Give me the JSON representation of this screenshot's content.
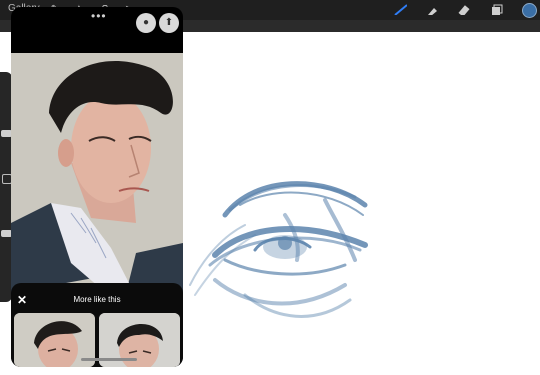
{
  "toolbar": {
    "gallery_label": "Gallery",
    "tools_left": [
      "wrench-icon",
      "magic-icon",
      "selection-icon",
      "transform-icon"
    ],
    "tools_right": [
      "brush-icon",
      "smudge-icon",
      "eraser-icon",
      "layers-icon"
    ],
    "active_color": "#3a6ea5"
  },
  "panel": {
    "more_like_this": "More like this",
    "close_icon": "✕",
    "dots": "•••"
  },
  "colors": {
    "sketch_stroke": "#5c84ad",
    "panel_bg": "#000000",
    "canvas_bg": "#ffffff"
  }
}
